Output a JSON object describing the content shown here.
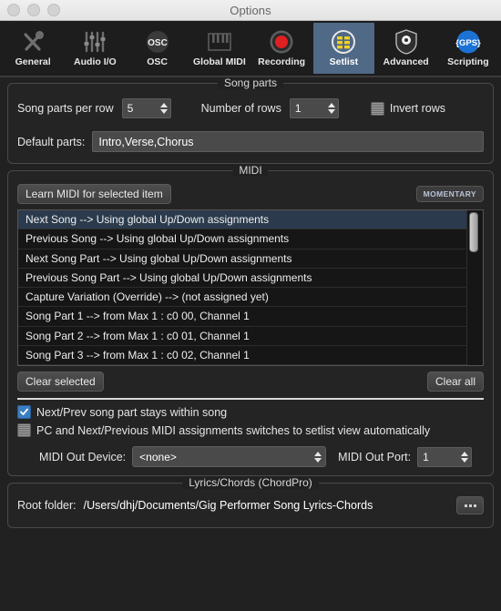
{
  "window": {
    "title": "Options"
  },
  "toolbar": {
    "tabs": [
      {
        "label": "General",
        "icon": "wrench-screwdriver-icon",
        "selected": false
      },
      {
        "label": "Audio I/O",
        "icon": "sliders-icon",
        "selected": false
      },
      {
        "label": "OSC",
        "icon": "osc-icon",
        "selected": false
      },
      {
        "label": "Global MIDI",
        "icon": "piano-keys-icon",
        "selected": false
      },
      {
        "label": "Recording",
        "icon": "record-circle-icon",
        "selected": false
      },
      {
        "label": "Setlist",
        "icon": "setlist-grid-icon",
        "selected": true
      },
      {
        "label": "Advanced",
        "icon": "shield-gear-icon",
        "selected": false
      },
      {
        "label": "Scripting",
        "icon": "gps-script-icon",
        "selected": false
      }
    ],
    "osc_icon_text": "OSC",
    "scripting_icon_text": "{GPS}"
  },
  "song_parts": {
    "group_title": "Song parts",
    "per_row_label": "Song parts per row",
    "per_row_value": "5",
    "rows_label": "Number of rows",
    "rows_value": "1",
    "invert_rows_label": "Invert rows",
    "invert_rows_checked": false,
    "default_parts_label": "Default parts:",
    "default_parts_value": "Intro,Verse,Chorus"
  },
  "midi": {
    "group_title": "MIDI",
    "learn_button": "Learn MIDI for selected item",
    "momentary_badge": "MOMENTARY",
    "assignments": [
      {
        "text": "Next Song --> Using global Up/Down assignments",
        "selected": true
      },
      {
        "text": "Previous Song --> Using global Up/Down assignments",
        "selected": false
      },
      {
        "text": "Next Song Part --> Using global Up/Down assignments",
        "selected": false
      },
      {
        "text": "Previous Song Part --> Using global Up/Down assignments",
        "selected": false
      },
      {
        "text": "Capture Variation (Override) --> (not assigned yet)",
        "selected": false
      },
      {
        "text": "Song Part 1 --> from Max 1 : c0 00, Channel 1",
        "selected": false
      },
      {
        "text": "Song Part 2 --> from Max 1 : c0 01, Channel 1",
        "selected": false
      },
      {
        "text": "Song Part 3 --> from Max 1 : c0 02, Channel 1",
        "selected": false
      }
    ],
    "clear_selected_button": "Clear selected",
    "clear_all_button": "Clear all",
    "stays_within_song_label": "Next/Prev song part stays within song",
    "stays_within_song_checked": true,
    "pc_switches_label": "PC and Next/Previous MIDI assignments switches to setlist view automatically",
    "pc_switches_checked": false,
    "out_device_label": "MIDI Out Device:",
    "out_device_value": "<none>",
    "out_port_label": "MIDI Out Port:",
    "out_port_value": "1"
  },
  "lyrics": {
    "group_title": "Lyrics/Chords (ChordPro)",
    "root_folder_label": "Root folder:",
    "root_folder_value": "/Users/dhj/Documents/Gig Performer Song Lyrics-Chords",
    "browse_button": "..."
  },
  "colors": {
    "accent_selected_tab": "#506986",
    "checkbox_on": "#3a7fc4",
    "row_selected": "#2b3b4d",
    "setlist_icon_yellow": "#f2d024",
    "record_red": "#e02020",
    "scripting_blue": "#1c72d4"
  }
}
